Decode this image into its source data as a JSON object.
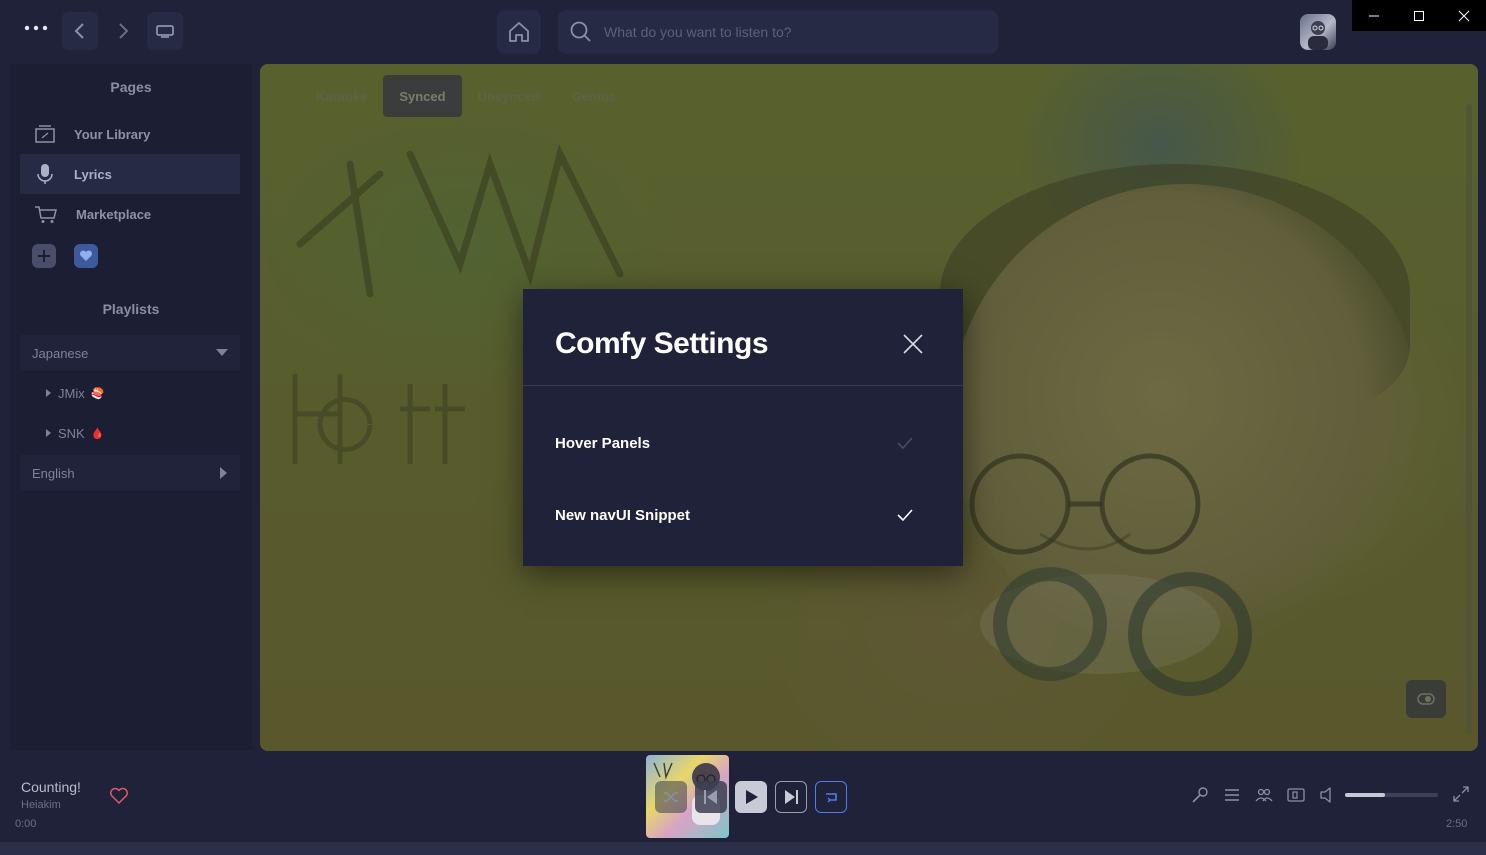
{
  "topbar": {
    "search_placeholder": "What do you want to listen to?"
  },
  "sidebar": {
    "pages_title": "Pages",
    "items": [
      {
        "label": "Your Library",
        "icon": "library-icon"
      },
      {
        "label": "Lyrics",
        "icon": "microphone-icon",
        "active": true
      },
      {
        "label": "Marketplace",
        "icon": "cart-icon"
      }
    ],
    "playlists_title": "Playlists",
    "folders": [
      {
        "label": "Japanese",
        "expanded": true,
        "children": [
          {
            "label": "JMix",
            "emoji": "🍣"
          },
          {
            "label": "SNK",
            "emoji": "🩸"
          }
        ]
      },
      {
        "label": "English",
        "expanded": false
      }
    ]
  },
  "lyrics_tabs": [
    "Karaoke",
    "Synced",
    "Unsynced",
    "Genius"
  ],
  "lyrics_active_tab": "Synced",
  "modal": {
    "title": "Comfy Settings",
    "settings": [
      {
        "label": "Hover Panels",
        "checked": false
      },
      {
        "label": "New navUI Snippet",
        "checked": true
      }
    ]
  },
  "player": {
    "track_title": "Counting!",
    "artist": "Heiakim",
    "time_elapsed": "0:00",
    "time_total": "2:50",
    "volume_fraction": 0.43
  },
  "colors": {
    "background": "#1f2238",
    "modal_bg": "#1f2238",
    "accent_blue": "#4f7cf0",
    "heart_red": "#e05a67"
  }
}
